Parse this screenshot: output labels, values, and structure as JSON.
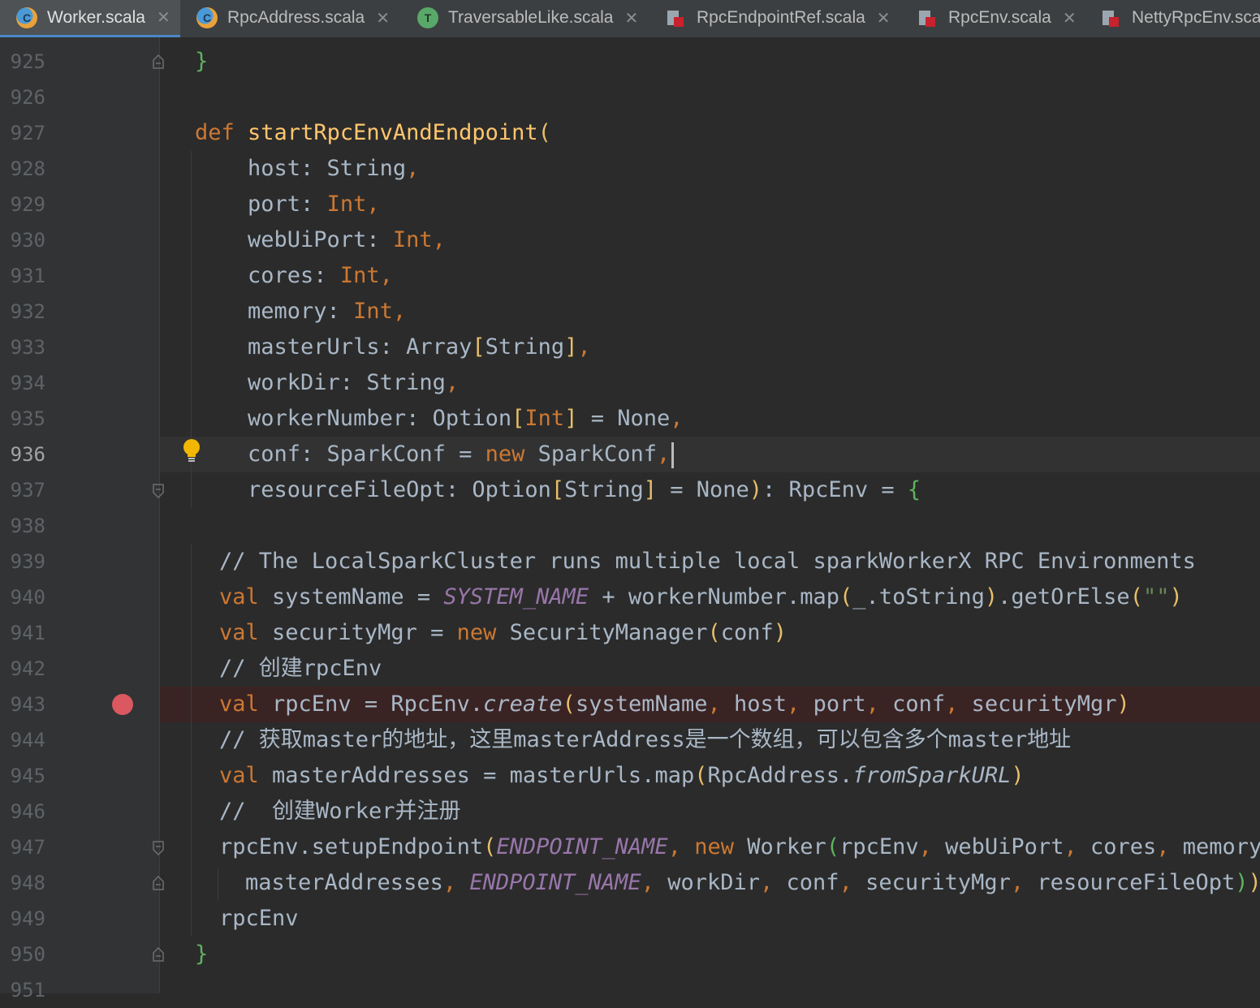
{
  "tabs": [
    {
      "label": "Worker.scala",
      "icon": "scala-class-icon",
      "active": true
    },
    {
      "label": "RpcAddress.scala",
      "icon": "scala-class-icon",
      "active": false
    },
    {
      "label": "TraversableLike.scala",
      "icon": "scala-trait-icon",
      "active": false
    },
    {
      "label": "RpcEndpointRef.scala",
      "icon": "java-file-icon",
      "active": false
    },
    {
      "label": "RpcEnv.scala",
      "icon": "java-file-icon",
      "active": false
    },
    {
      "label": "NettyRpcEnv.sca",
      "icon": "java-file-icon",
      "active": false
    }
  ],
  "editor": {
    "current_line": "936",
    "breakpoint_line": "943",
    "line_numbers": [
      "925",
      "926",
      "927",
      "928",
      "929",
      "930",
      "931",
      "932",
      "933",
      "934",
      "935",
      "936",
      "937",
      "938",
      "939",
      "940",
      "941",
      "942",
      "943",
      "944",
      "945",
      "946",
      "947",
      "948",
      "949",
      "950",
      "951"
    ],
    "code_text": {
      "l939_comment": "// The LocalSparkCluster runs multiple local sparkWorkerX RPC Environments",
      "l942_comment": "// 创建rpcEnv",
      "l944_comment": "// 获取master的地址，这里masterAddress是一个数组，可以包含多个master地址",
      "l946_comment": "//  创建Worker并注册"
    }
  },
  "colors": {
    "background": "#2b2b2b",
    "gutter": "#313335",
    "keyword": "#cc7832",
    "function": "#ffc66d",
    "comment": "#808080",
    "constant": "#9876aa",
    "breakpoint": "#db5860"
  }
}
